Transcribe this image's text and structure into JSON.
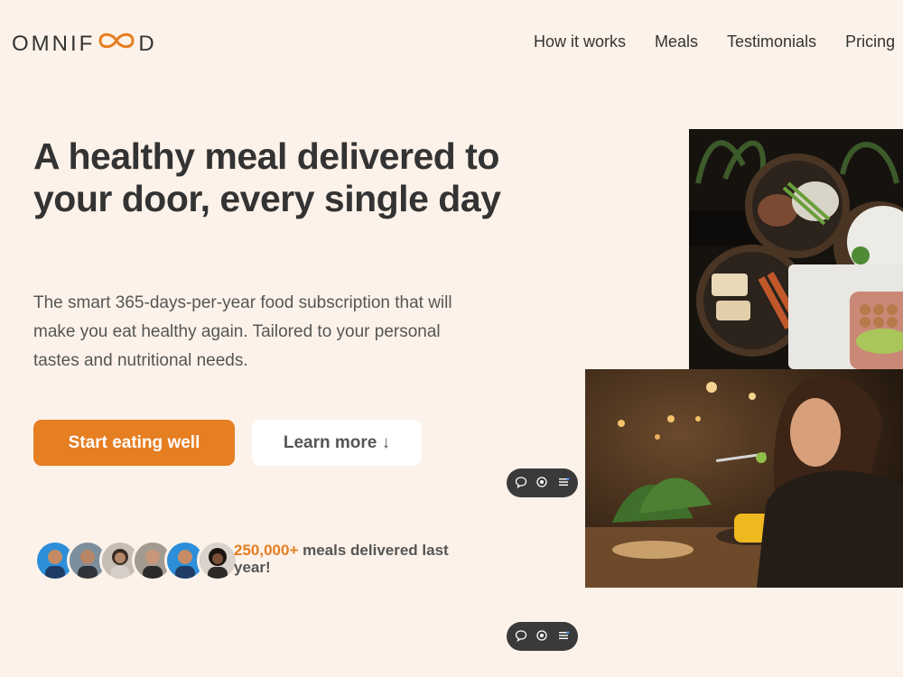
{
  "brand": {
    "prefix": "OMNIF",
    "suffix": "D",
    "logo_icon": "infinity-icon",
    "accent": "#e67e22"
  },
  "nav": {
    "items": [
      "How it works",
      "Meals",
      "Testimonials",
      "Pricing"
    ]
  },
  "hero": {
    "headline": "A healthy meal delivered to your door, every single day",
    "description": "The smart 365-days-per-year food subscription that will make you eat healthy again. Tailored to your personal tastes and nutritional needs.",
    "primary_cta": "Start eating well",
    "secondary_cta": "Learn more ↓",
    "stat_number": "250,000+",
    "stat_text": " meals delivered last year!"
  },
  "floating_toolbar": {
    "icons": [
      "comment-icon",
      "eye-icon",
      "menu-icon"
    ]
  },
  "colors": {
    "background": "#fdf2e9",
    "text": "#333333",
    "button_primary": "#e67e22"
  }
}
